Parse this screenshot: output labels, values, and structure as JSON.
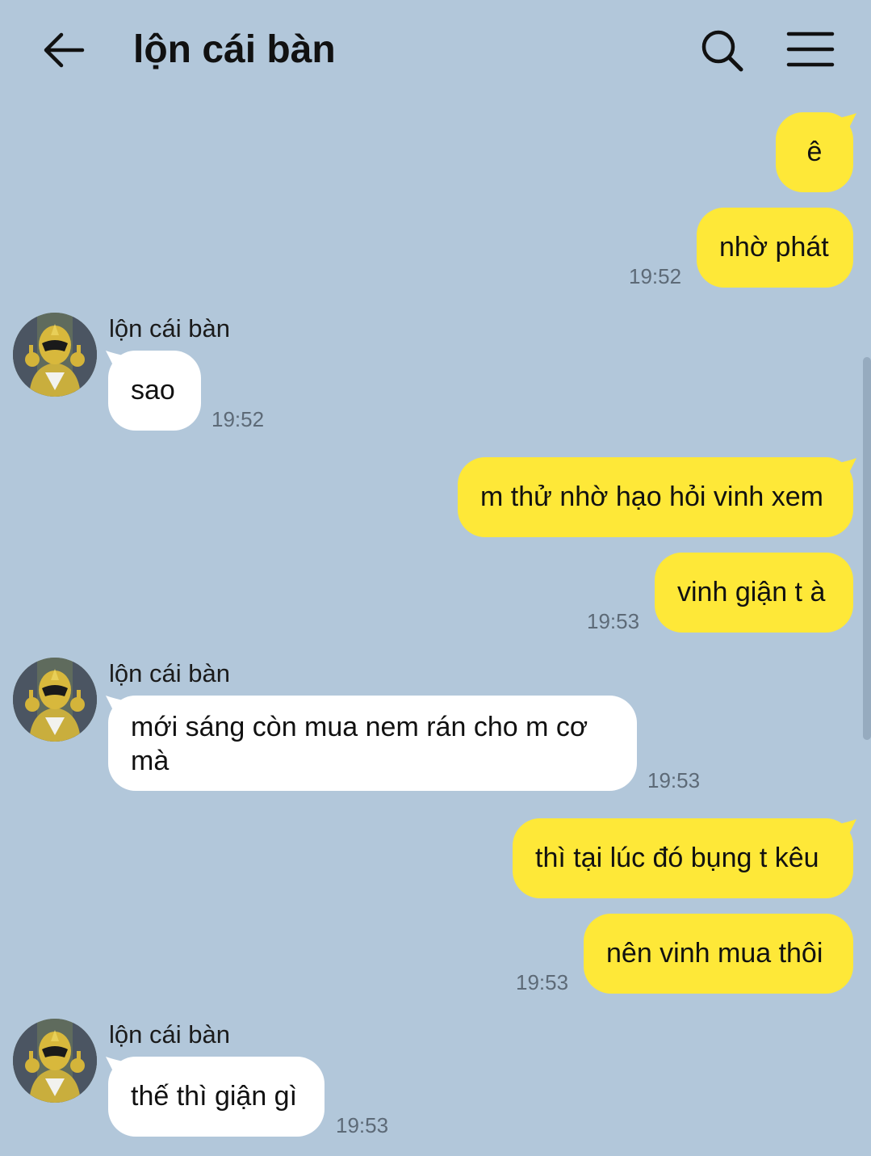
{
  "header": {
    "title": "lộn cái bàn"
  },
  "colors": {
    "background": "#b2c7da",
    "my_bubble": "#fee838",
    "their_bubble": "#ffffff"
  },
  "messages": [
    {
      "from": "me",
      "text": "ê"
    },
    {
      "from": "me",
      "text": "nhờ phát",
      "time": "19:52"
    },
    {
      "from": "them",
      "sender": "lộn cái bàn",
      "text": "sao",
      "time": "19:52"
    },
    {
      "from": "me",
      "text": "m thử nhờ hạo hỏi vinh xem"
    },
    {
      "from": "me",
      "text": "vinh giận t à",
      "time": "19:53"
    },
    {
      "from": "them",
      "sender": "lộn cái bàn",
      "text": "mới sáng còn mua nem rán cho m cơ mà",
      "time": "19:53"
    },
    {
      "from": "me",
      "text": "thì tại lúc đó bụng t kêu"
    },
    {
      "from": "me",
      "text": "nên vinh mua thôi",
      "time": "19:53"
    },
    {
      "from": "them",
      "sender": "lộn cái bàn",
      "text": "thế thì giận gì",
      "time": "19:53"
    }
  ]
}
